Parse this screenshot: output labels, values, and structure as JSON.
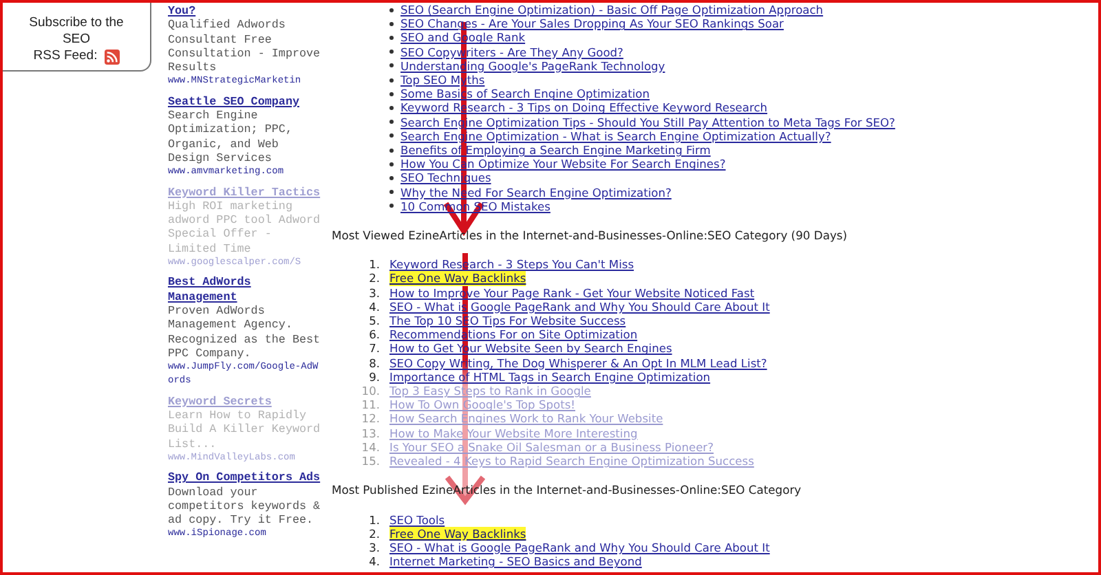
{
  "rss_box": {
    "lines": [
      "Subscribe to the",
      "SEO"
    ],
    "feed_label": "RSS Feed:"
  },
  "ads": [
    {
      "title": "You?",
      "body": "Qualified Adwords Consultant Free Consultation - Improve Results",
      "url": "www.MNStrategicMarketin",
      "faded": false
    },
    {
      "title": "Seattle SEO Company",
      "body": "Search Engine Optimization; PPC, Organic, and Web Design Services",
      "url": "www.amvmarketing.com",
      "faded": false
    },
    {
      "title": "Keyword Killer Tactics",
      "body": "High ROI marketing adword PPC tool Adword Special Offer - Limited Time",
      "url": "www.googlescalper.com/S",
      "faded": true
    },
    {
      "title": "Best AdWords Management",
      "body": "Proven AdWords Management Agency. Recognized as the Best PPC Company.",
      "url": "www.JumpFly.com/Google-AdWords",
      "faded": false
    },
    {
      "title": "Keyword Secrets",
      "body": "Learn How to Rapidly Build A Killer Keyword List...",
      "url": "www.MindValleyLabs.com",
      "faded": true
    },
    {
      "title": "Spy On Competitors Ads",
      "body": "Download your competitors keywords & ad copy. Try it Free.",
      "url": "www.iSpionage.com",
      "faded": false
    }
  ],
  "related_articles": [
    "SEO (Search Engine Optimization) - Basic Off Page Optimization Approach",
    "SEO Changes - Are Your Sales Dropping As Your SEO Rankings Soar",
    "SEO and Google Rank",
    "SEO Copywriters - Are They Any Good?",
    "Understanding Google's PageRank Technology",
    "Top SEO Myths",
    "Some Basics of Search Engine Optimization",
    "Keyword Research - 3 Tips on Doing Effective Keyword Research",
    "Search Engine Optimization Tips - Should You Still Pay Attention to Meta Tags For SEO?",
    "Search Engine Optimization - What is Search Engine Optimization Actually?",
    "Benefits of Employing a Search Engine Marketing Firm",
    "How You Can Optimize Your Website For Search Engines?",
    "SEO Techniques",
    "Why the Need For Search Engine Optimization?",
    "10 Common SEO Mistakes"
  ],
  "most_viewed": {
    "heading": "Most Viewed EzineArticles in the Internet-and-Businesses-Online:SEO Category (90 Days)",
    "items": [
      {
        "number": "1.",
        "title": "Keyword Research - 3 Steps You Can't Miss",
        "highlighted": false,
        "faded": false
      },
      {
        "number": "2.",
        "title": "Free One Way Backlinks",
        "highlighted": true,
        "faded": false
      },
      {
        "number": "3.",
        "title": "How to Improve Your Page Rank - Get Your Website Noticed Fast",
        "highlighted": false,
        "faded": false
      },
      {
        "number": "4.",
        "title": "SEO - What is Google PageRank and Why You Should Care About It",
        "highlighted": false,
        "faded": false
      },
      {
        "number": "5.",
        "title": "The Top 10 SEO Tips For Website Success",
        "highlighted": false,
        "faded": false
      },
      {
        "number": "6.",
        "title": "Recommendations For on Site Optimization",
        "highlighted": false,
        "faded": false
      },
      {
        "number": "7.",
        "title": "How to Get Your Website Seen by Search Engines",
        "highlighted": false,
        "faded": false
      },
      {
        "number": "8.",
        "title": "SEO Copy Writing, The Dog Whisperer & An Opt In MLM Lead List?",
        "highlighted": false,
        "faded": false
      },
      {
        "number": "9.",
        "title": "Importance of HTML Tags in Search Engine Optimization",
        "highlighted": false,
        "faded": false
      },
      {
        "number": "10.",
        "title": "Top 3 Easy Steps to Rank in Google",
        "highlighted": false,
        "faded": true
      },
      {
        "number": "11.",
        "title": "How To Own Google's Top Spots!",
        "highlighted": false,
        "faded": true
      },
      {
        "number": "12.",
        "title": "How Search Engines Work to Rank Your Website",
        "highlighted": false,
        "faded": true
      },
      {
        "number": "13.",
        "title": "How to Make Your Website More Interesting",
        "highlighted": false,
        "faded": true
      },
      {
        "number": "14.",
        "title": "Is Your SEO a Snake Oil Salesman or a Business Pioneer?",
        "highlighted": false,
        "faded": true
      },
      {
        "number": "15.",
        "title": "Revealed - 4 Keys to Rapid Search Engine Optimization Success",
        "highlighted": false,
        "faded": true
      }
    ]
  },
  "most_published": {
    "heading": "Most Published EzineArticles in the Internet-and-Businesses-Online:SEO Category",
    "items": [
      {
        "number": "1.",
        "title": "SEO Tools",
        "highlighted": false,
        "faded": false
      },
      {
        "number": "2.",
        "title": "Free One Way Backlinks",
        "highlighted": true,
        "faded": false
      },
      {
        "number": "3.",
        "title": "SEO - What is Google PageRank and Why You Should Care About It",
        "highlighted": false,
        "faded": false
      },
      {
        "number": "4.",
        "title": "Internet Marketing - SEO Basics and Beyond",
        "highlighted": false,
        "faded": false
      }
    ]
  }
}
